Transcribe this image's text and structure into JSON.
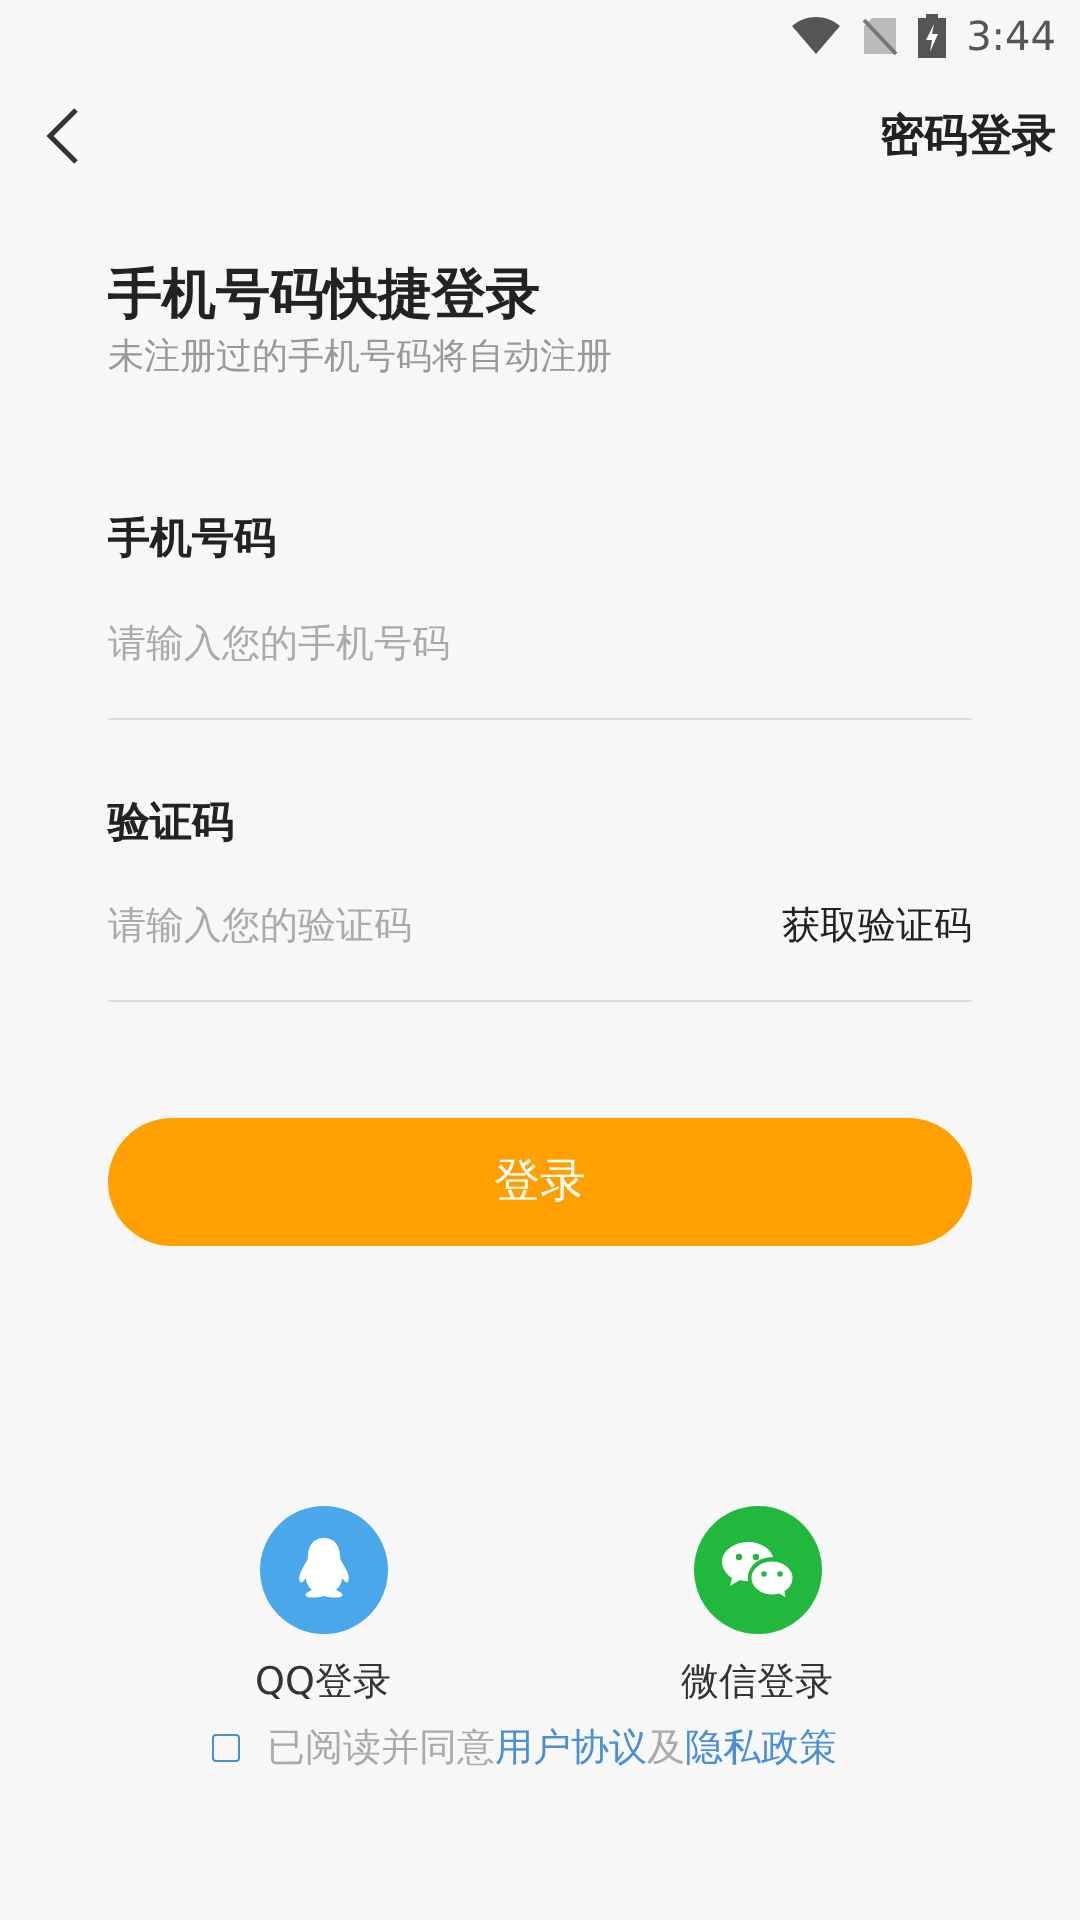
{
  "status_bar": {
    "time": "3:44"
  },
  "header": {
    "action": "密码登录"
  },
  "title": "手机号码快捷登录",
  "subtitle": "未注册过的手机号码将自动注册",
  "phone_field": {
    "label": "手机号码",
    "placeholder": "请输入您的手机号码"
  },
  "code_field": {
    "label": "验证码",
    "placeholder": "请输入您的验证码",
    "button": "获取验证码"
  },
  "login_button": "登录",
  "social_logins": [
    {
      "kind": "qq",
      "label": "QQ登录"
    },
    {
      "kind": "wechat",
      "label": "微信登录"
    }
  ],
  "agreement": {
    "checked": false,
    "prefix": "已阅读并同意",
    "terms_link": "用户协议",
    "conjunction": "及",
    "privacy_link": "隐私政策"
  }
}
